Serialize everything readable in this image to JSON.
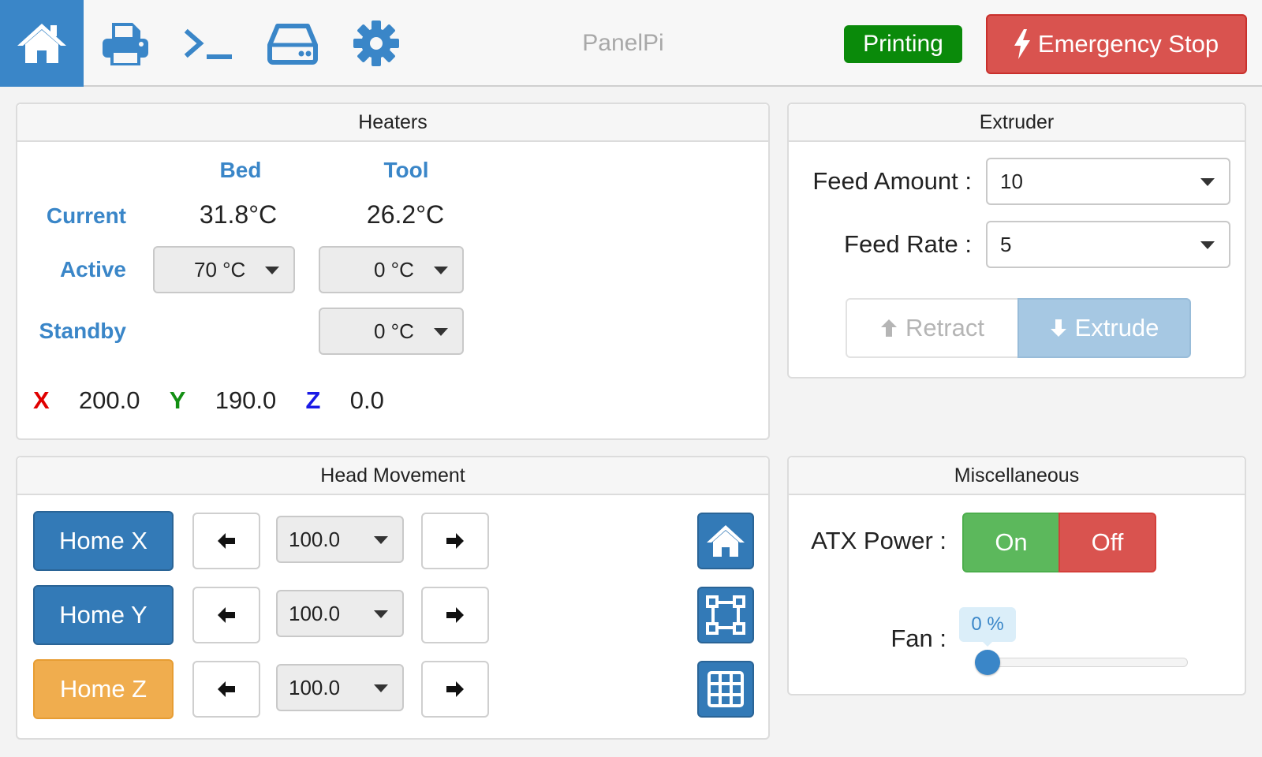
{
  "app": {
    "brand": "PanelPi",
    "nav": [
      {
        "id": "home",
        "icon": "home-icon"
      },
      {
        "id": "print",
        "icon": "printer-icon"
      },
      {
        "id": "console",
        "icon": "terminal-icon"
      },
      {
        "id": "storage",
        "icon": "hard-drive-icon"
      },
      {
        "id": "settings",
        "icon": "gear-icon"
      }
    ],
    "status": "Printing",
    "emergency_stop": "Emergency Stop"
  },
  "heaters": {
    "title": "Heaters",
    "col_bed": "Bed",
    "col_tool": "Tool",
    "row_current": "Current",
    "row_active": "Active",
    "row_standby": "Standby",
    "bed_current": "31.8°C",
    "tool_current": "26.2°C",
    "bed_active": "70 °C",
    "tool_active": "0 °C",
    "tool_standby": "0 °C",
    "position": {
      "x_label": "X",
      "x_value": "200.0",
      "y_label": "Y",
      "y_value": "190.0",
      "z_label": "Z",
      "z_value": "0.0"
    }
  },
  "extruder": {
    "title": "Extruder",
    "feed_amount_label": "Feed Amount :",
    "feed_amount_value": "10",
    "feed_rate_label": "Feed Rate :",
    "feed_rate_value": "5",
    "retract_label": "Retract",
    "extrude_label": "Extrude"
  },
  "head_movement": {
    "title": "Head Movement",
    "rows": [
      {
        "home_label": "Home X",
        "step": "100.0"
      },
      {
        "home_label": "Home Y",
        "step": "100.0"
      },
      {
        "home_label": "Home Z",
        "step": "100.0"
      }
    ]
  },
  "misc": {
    "title": "Miscellaneous",
    "atx_label": "ATX Power :",
    "on_label": "On",
    "off_label": "Off",
    "fan_label": "Fan :",
    "fan_value": "0 %",
    "fan_level": 0
  },
  "colors": {
    "primary": "#337ab7",
    "nav_active": "#3a86c8",
    "printing": "#0a8a0a",
    "danger": "#d9534f",
    "success": "#5cb85c",
    "warning": "#f0ad4e"
  }
}
